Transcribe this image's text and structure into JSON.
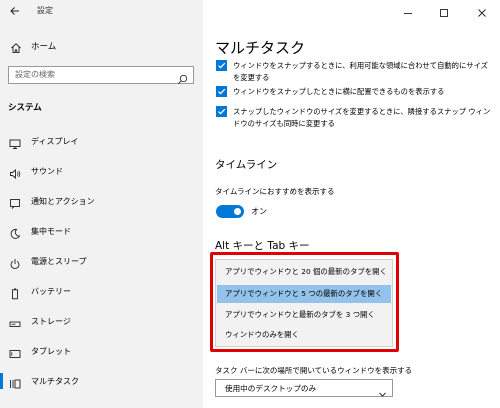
{
  "app": {
    "title": "設定"
  },
  "sidebar": {
    "home_label": "ホーム",
    "search_placeholder": "設定の検索",
    "section_title": "システム",
    "items": [
      {
        "label": "ディスプレイ",
        "icon": "display-icon"
      },
      {
        "label": "サウンド",
        "icon": "speaker-icon"
      },
      {
        "label": "通知とアクション",
        "icon": "notification-icon"
      },
      {
        "label": "集中モード",
        "icon": "moon-icon"
      },
      {
        "label": "電源とスリープ",
        "icon": "power-icon"
      },
      {
        "label": "バッテリー",
        "icon": "battery-icon"
      },
      {
        "label": "ストレージ",
        "icon": "storage-icon"
      },
      {
        "label": "タブレット",
        "icon": "tablet-icon"
      },
      {
        "label": "マルチタスク",
        "icon": "multitask-icon",
        "selected": true
      }
    ]
  },
  "main": {
    "title": "マルチタスク",
    "snap_options": [
      {
        "label": "ウィンドウをスナップするときに、利用可能な領域に合わせて自動的にサイズを変更する",
        "checked": true
      },
      {
        "label": "ウィンドウをスナップしたときに横に配置できるものを表示する",
        "checked": true
      },
      {
        "label": "スナップしたウィンドウのサイズを変更するときに、隣接するスナップ ウィンドウのサイズも同時に変更する",
        "checked": true
      }
    ],
    "timeline": {
      "title": "タイムライン",
      "label": "タイムラインにおすすめを表示する",
      "toggle_state": "オン",
      "toggle_on": true
    },
    "alt_tab": {
      "title": "Alt キーと Tab キー",
      "options": [
        "アプリでウィンドウと 20 個の最新のタブを開く",
        "アプリでウィンドウと 5 つの最新のタブを開く",
        "アプリでウィンドウと最新のタブを 3 つ開く",
        "ウィンドウのみを開く"
      ],
      "highlighted_index": 1
    },
    "taskbar": {
      "label": "タスク バーに次の場所で開いているウィンドウを表示する",
      "value": "使用中のデスクトップのみ"
    }
  },
  "colors": {
    "accent": "#0078d7",
    "highlight": "#93c2ea",
    "annotation_frame": "#e10000",
    "sidebar_bg": "#f2f2f2"
  }
}
